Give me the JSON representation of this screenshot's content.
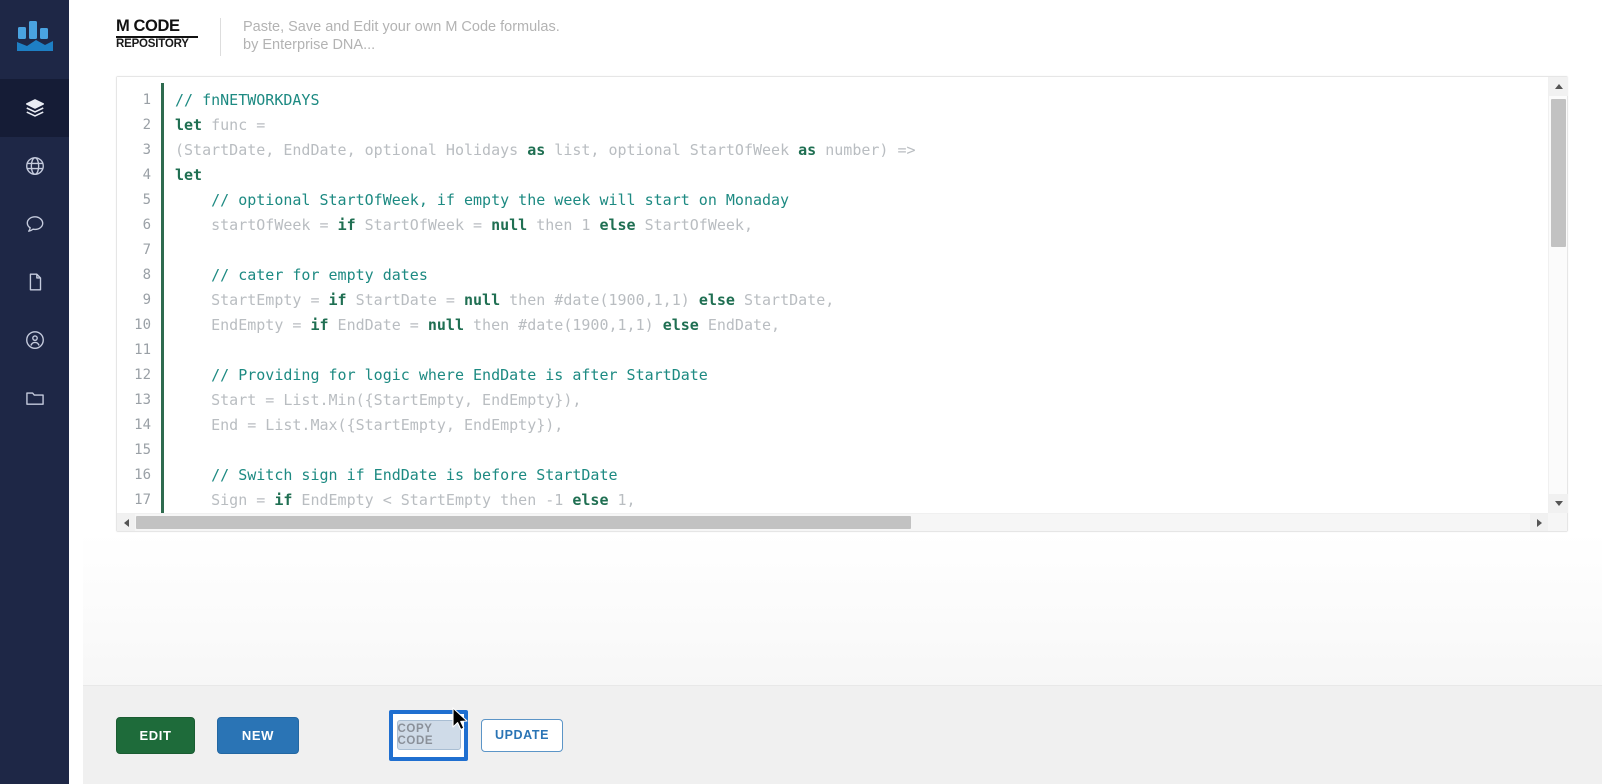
{
  "sidebar": {
    "logo_name": "enterprise-dna-logo",
    "items": [
      {
        "name": "sidebar-item-repository",
        "icon": "layers-icon",
        "active": true
      },
      {
        "name": "sidebar-item-globe",
        "icon": "globe-icon",
        "active": false
      },
      {
        "name": "sidebar-item-chat",
        "icon": "chat-bubble-icon",
        "active": false
      },
      {
        "name": "sidebar-item-document",
        "icon": "document-icon",
        "active": false
      },
      {
        "name": "sidebar-item-account",
        "icon": "user-circle-icon",
        "active": false
      },
      {
        "name": "sidebar-item-folder",
        "icon": "folder-icon",
        "active": false
      }
    ]
  },
  "header": {
    "brand_line1": "M CODE",
    "brand_line2": "REPOSITORY",
    "tagline_line1": "Paste, Save and Edit your own M Code formulas.",
    "tagline_line2": "by Enterprise DNA..."
  },
  "editor": {
    "line_numbers": [
      "1",
      "2",
      "3",
      "4",
      "5",
      "6",
      "7",
      "8",
      "9",
      "10",
      "11",
      "12",
      "13",
      "14",
      "15",
      "16",
      "17"
    ],
    "lines": [
      [
        {
          "t": "// fnNETWORKDAYS",
          "c": "com"
        }
      ],
      [
        {
          "t": "let",
          "c": "kw"
        },
        {
          "t": " func =",
          "c": "id"
        }
      ],
      [
        {
          "t": "(StartDate, EndDate, optional Holidays ",
          "c": "id"
        },
        {
          "t": "as",
          "c": "kw"
        },
        {
          "t": " list, optional StartOfWeek ",
          "c": "id"
        },
        {
          "t": "as",
          "c": "kw"
        },
        {
          "t": " number) =>",
          "c": "id"
        }
      ],
      [
        {
          "t": "let",
          "c": "kw"
        }
      ],
      [
        {
          "t": "    // optional StartOfWeek, if empty the week will start on Monaday",
          "c": "com"
        }
      ],
      [
        {
          "t": "    startOfWeek = ",
          "c": "id"
        },
        {
          "t": "if",
          "c": "kw"
        },
        {
          "t": " StartOfWeek = ",
          "c": "id"
        },
        {
          "t": "null",
          "c": "kw"
        },
        {
          "t": " then 1 ",
          "c": "id"
        },
        {
          "t": "else",
          "c": "kw"
        },
        {
          "t": " StartOfWeek,",
          "c": "id"
        }
      ],
      [
        {
          "t": "",
          "c": "id"
        }
      ],
      [
        {
          "t": "    // cater for empty dates",
          "c": "com"
        }
      ],
      [
        {
          "t": "    StartEmpty = ",
          "c": "id"
        },
        {
          "t": "if",
          "c": "kw"
        },
        {
          "t": " StartDate = ",
          "c": "id"
        },
        {
          "t": "null",
          "c": "kw"
        },
        {
          "t": " then #date(1900,1,1) ",
          "c": "id"
        },
        {
          "t": "else",
          "c": "kw"
        },
        {
          "t": " StartDate,",
          "c": "id"
        }
      ],
      [
        {
          "t": "    EndEmpty = ",
          "c": "id"
        },
        {
          "t": "if",
          "c": "kw"
        },
        {
          "t": " EndDate = ",
          "c": "id"
        },
        {
          "t": "null",
          "c": "kw"
        },
        {
          "t": " then #date(1900,1,1) ",
          "c": "id"
        },
        {
          "t": "else",
          "c": "kw"
        },
        {
          "t": " EndDate,",
          "c": "id"
        }
      ],
      [
        {
          "t": "",
          "c": "id"
        }
      ],
      [
        {
          "t": "    // Providing for logic where EndDate is after StartDate",
          "c": "com"
        }
      ],
      [
        {
          "t": "    Start = List.Min({StartEmpty, EndEmpty}),",
          "c": "id"
        }
      ],
      [
        {
          "t": "    End = List.Max({StartEmpty, EndEmpty}),",
          "c": "id"
        }
      ],
      [
        {
          "t": "",
          "c": "id"
        }
      ],
      [
        {
          "t": "    // Switch sign if EndDate is before StartDate",
          "c": "com"
        }
      ],
      [
        {
          "t": "    Sign = ",
          "c": "id"
        },
        {
          "t": "if",
          "c": "kw"
        },
        {
          "t": " EndEmpty < StartEmpty then -1 ",
          "c": "id"
        },
        {
          "t": "else",
          "c": "kw"
        },
        {
          "t": " 1,",
          "c": "id"
        }
      ]
    ]
  },
  "actions": {
    "edit_label": "EDIT",
    "new_label": "NEW",
    "copy_label": "COPY CODE",
    "update_label": "UPDATE"
  },
  "colors": {
    "sidebar_bg": "#1e2746",
    "accent_blue": "#2a74b5",
    "focus_blue": "#1f6fd0",
    "edit_green": "#1e6b3a",
    "comment_teal": "#1d8a82",
    "keyword_green": "#1f6f52",
    "gutter_green": "#2e6b4f"
  }
}
